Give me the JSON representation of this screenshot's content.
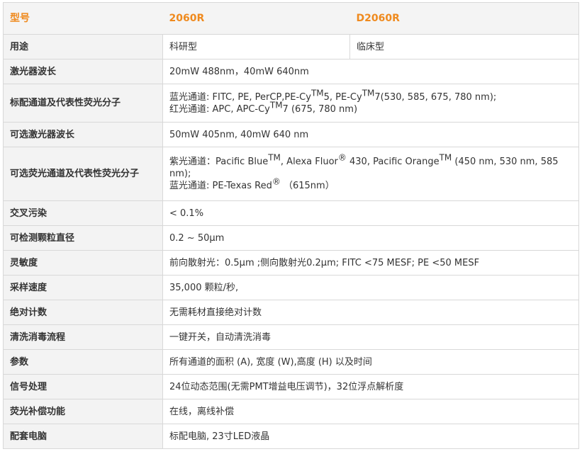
{
  "header": {
    "label": "型号",
    "model1": "2060R",
    "model2": "D2060R"
  },
  "usage": {
    "label": "用途",
    "model1": "科研型",
    "model2": "临床型"
  },
  "rows": [
    {
      "label": "激光器波长",
      "value": "20mW 488nm，40mW 640nm"
    },
    {
      "label": "标配通道及代表性荧光分子"
    },
    {
      "label": "可选激光器波长",
      "value": "50mW 405nm, 40mW 640 nm"
    },
    {
      "label": "可选荧光通道及代表性荧光分子"
    },
    {
      "label": "交叉污染",
      "value": "< 0.1%"
    },
    {
      "label": "可检测颗粒直径",
      "value": "0.2 ~ 50μm"
    },
    {
      "label": "灵敏度",
      "value": "前向散射光：0.5μm ;侧向散射光0.2μm; FITC <75 MESF; PE <50 MESF"
    },
    {
      "label": "采样速度",
      "value": "35,000 颗粒/秒,"
    },
    {
      "label": "绝对计数",
      "value": "无需耗材直接绝对计数"
    },
    {
      "label": "清洗消毒流程",
      "value": "一键开关，自动清洗消毒"
    },
    {
      "label": "参数",
      "value": "所有通道的面积 (A), 宽度 (W),高度 (H) 以及时间"
    },
    {
      "label": "信号处理",
      "value": "24位动态范围(无需PMT增益电压调节)，32位浮点解析度"
    },
    {
      "label": "荧光补偿功能",
      "value": "在线，离线补偿"
    },
    {
      "label": "配套电脑",
      "value": "标配电脑, 23寸LED液晶"
    }
  ],
  "standard_channels": {
    "blue_a": "蓝光通道: FITC, PE, PerCP,PE-Cy",
    "tm1": "TM",
    "blue_b": "5, PE-Cy",
    "tm2": "TM",
    "blue_c": "7(530, 585, 675, 780 nm);",
    "red_a": "红光通道: APC, APC-Cy",
    "tm3": "TM",
    "red_b": "7 (675, 780 nm)"
  },
  "optional_channels": {
    "violet_a": "紫光通道：Pacific Blue",
    "tm1": "TM",
    "violet_b": ", Alexa Fluor",
    "reg": "®",
    "violet_c": " 430, Pacific Orange",
    "tm2": "TM",
    "violet_d": " (450 nm, 530 nm, 585 nm);",
    "blue_a": "蓝光通道:  PE-Texas Red",
    "reg2": "®",
    "blue_b": " （615nm）"
  },
  "colors": {
    "accent": "#ef8a1e",
    "label_bg": "#f3f3f3",
    "border": "#d8d8d8",
    "text": "#333333"
  }
}
